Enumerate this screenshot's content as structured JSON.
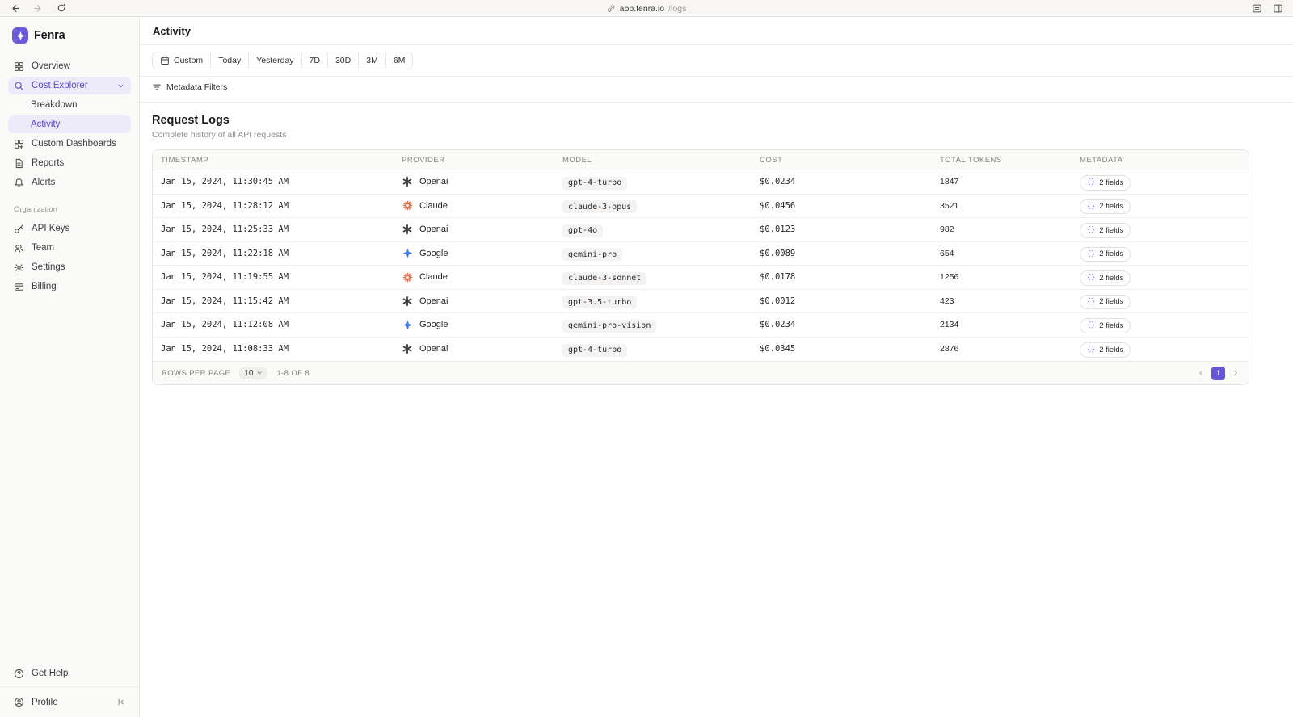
{
  "browser": {
    "url_host": "app.fenra.io",
    "url_path": "/logs"
  },
  "sidebar": {
    "brand": "Fenra",
    "items": [
      {
        "label": "Overview",
        "icon": "grid-icon"
      },
      {
        "label": "Cost Explorer",
        "icon": "search-icon",
        "active": true,
        "trailing": "chevron-down-icon"
      },
      {
        "label": "Breakdown",
        "sub": true
      },
      {
        "label": "Activity",
        "sub": true,
        "active": true
      },
      {
        "label": "Custom Dashboards",
        "icon": "dashboards-icon"
      },
      {
        "label": "Reports",
        "icon": "report-icon"
      },
      {
        "label": "Alerts",
        "icon": "bell-icon"
      }
    ],
    "section_label": "Organization",
    "org_items": [
      {
        "label": "API Keys",
        "icon": "key-icon"
      },
      {
        "label": "Team",
        "icon": "team-icon"
      },
      {
        "label": "Settings",
        "icon": "gear-icon"
      },
      {
        "label": "Billing",
        "icon": "card-icon"
      }
    ],
    "footer": {
      "get_help": "Get Help",
      "profile": "Profile"
    }
  },
  "header": {
    "title": "Activity"
  },
  "filters": {
    "date_ranges": [
      "Custom",
      "Today",
      "Yesterday",
      "7D",
      "30D",
      "3M",
      "6M"
    ],
    "metadata_filters_label": "Metadata Filters"
  },
  "logs": {
    "title": "Request Logs",
    "subtitle": "Complete history of all API requests",
    "columns": [
      "TIMESTAMP",
      "PROVIDER",
      "MODEL",
      "COST",
      "TOTAL TOKENS",
      "METADATA"
    ],
    "rows": [
      {
        "timestamp": "Jan 15, 2024, 11:30:45 AM",
        "provider": "Openai",
        "provider_icon": "openai-icon",
        "model": "gpt-4-turbo",
        "cost": "$0.0234",
        "tokens": "1847",
        "metadata": "2 fields"
      },
      {
        "timestamp": "Jan 15, 2024, 11:28:12 AM",
        "provider": "Claude",
        "provider_icon": "claude-icon",
        "model": "claude-3-opus",
        "cost": "$0.0456",
        "tokens": "3521",
        "metadata": "2 fields"
      },
      {
        "timestamp": "Jan 15, 2024, 11:25:33 AM",
        "provider": "Openai",
        "provider_icon": "openai-icon",
        "model": "gpt-4o",
        "cost": "$0.0123",
        "tokens": "982",
        "metadata": "2 fields"
      },
      {
        "timestamp": "Jan 15, 2024, 11:22:18 AM",
        "provider": "Google",
        "provider_icon": "google-icon",
        "model": "gemini-pro",
        "cost": "$0.0089",
        "tokens": "654",
        "metadata": "2 fields"
      },
      {
        "timestamp": "Jan 15, 2024, 11:19:55 AM",
        "provider": "Claude",
        "provider_icon": "claude-icon",
        "model": "claude-3-sonnet",
        "cost": "$0.0178",
        "tokens": "1256",
        "metadata": "2 fields"
      },
      {
        "timestamp": "Jan 15, 2024, 11:15:42 AM",
        "provider": "Openai",
        "provider_icon": "openai-icon",
        "model": "gpt-3.5-turbo",
        "cost": "$0.0012",
        "tokens": "423",
        "metadata": "2 fields"
      },
      {
        "timestamp": "Jan 15, 2024, 11:12:08 AM",
        "provider": "Google",
        "provider_icon": "google-icon",
        "model": "gemini-pro-vision",
        "cost": "$0.0234",
        "tokens": "2134",
        "metadata": "2 fields"
      },
      {
        "timestamp": "Jan 15, 2024, 11:08:33 AM",
        "provider": "Openai",
        "provider_icon": "openai-icon",
        "model": "gpt-4-turbo",
        "cost": "$0.0345",
        "tokens": "2876",
        "metadata": "2 fields"
      }
    ],
    "pagination": {
      "rows_per_page_label": "ROWS PER PAGE",
      "rows_per_page_value": "10",
      "range": "1-8 OF 8",
      "current_page": "1"
    }
  },
  "colors": {
    "accent_purple": "#6456d4",
    "active_nav_bg": "#edeafa",
    "active_nav_text": "#5649c6",
    "openai_dark": "#3f3f3f",
    "claude_orange": "#d97757",
    "google_blue": "#4285f4"
  }
}
